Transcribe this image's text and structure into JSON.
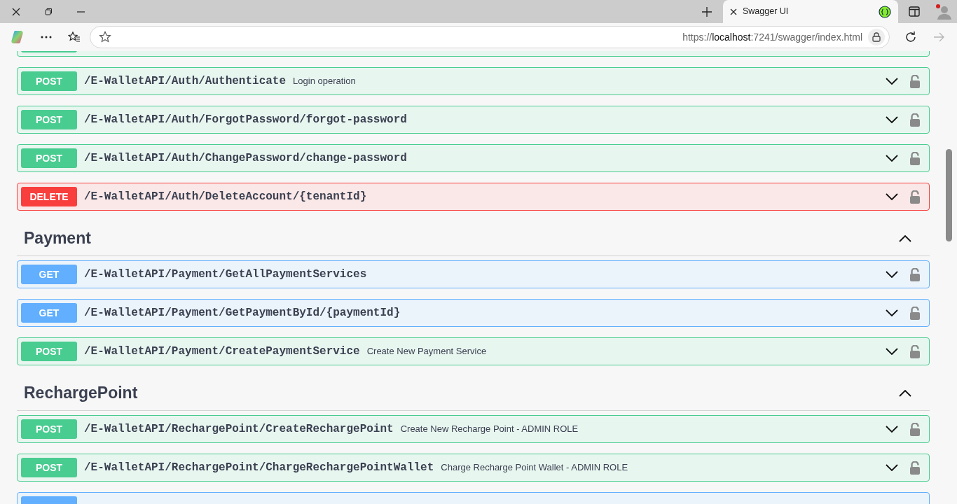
{
  "browser": {
    "tab_title": "Swagger UI",
    "url": "https://**localhost**:7241/swagger/index.html",
    "forward_disabled": true
  },
  "sections": [
    {
      "operations": [
        {
          "kind": "post"
        },
        {
          "kind": "post",
          "method": "POST",
          "path": "/E-WalletAPI/Auth/Authenticate",
          "summary": "Login operation"
        },
        {
          "kind": "post",
          "method": "POST",
          "path": "/E-WalletAPI/Auth/ForgotPassword/forgot-password"
        },
        {
          "kind": "post",
          "method": "POST",
          "path": "/E-WalletAPI/Auth/ChangePassword/change-password"
        },
        {
          "kind": "delete",
          "method": "DELETE",
          "path": "/E-WalletAPI/Auth/DeleteAccount/{tenantId}"
        }
      ]
    },
    {
      "name": "Payment",
      "expanded": true,
      "operations": [
        {
          "kind": "get",
          "method": "GET",
          "path": "/E-WalletAPI/Payment/GetAllPaymentServices"
        },
        {
          "kind": "get",
          "method": "GET",
          "path": "/E-WalletAPI/Payment/GetPaymentById/{paymentId}"
        },
        {
          "kind": "post",
          "method": "POST",
          "path": "/E-WalletAPI/Payment/CreatePaymentService",
          "summary": "Create New Payment Service"
        }
      ]
    },
    {
      "name": "RechargePoint",
      "expanded": true,
      "operations": [
        {
          "kind": "post",
          "method": "POST",
          "path": "/E-WalletAPI/RechargePoint/CreateRechargePoint",
          "summary": "Create New Recharge Point - ADMIN ROLE"
        },
        {
          "kind": "post",
          "method": "POST",
          "path": "/E-WalletAPI/RechargePoint/ChargeRechargePointWallet",
          "summary": "Charge Recharge Point Wallet - ADMIN ROLE"
        },
        {
          "kind": "get"
        }
      ]
    }
  ]
}
